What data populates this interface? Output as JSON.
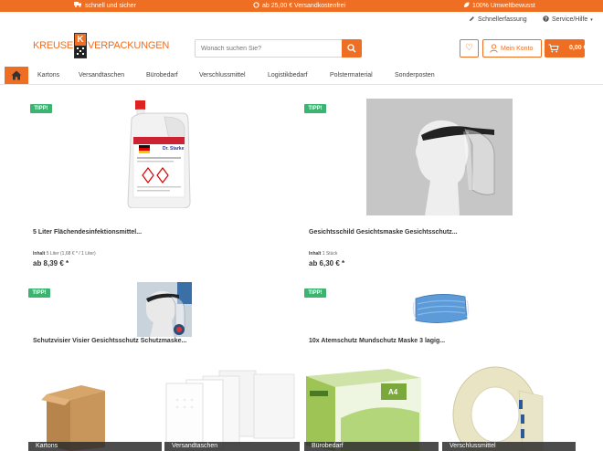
{
  "topbar": {
    "items": [
      {
        "icon": "truck-icon",
        "text": "schnell und sicher"
      },
      {
        "icon": "refresh-icon",
        "text": "ab 25,00 € Versandkostenfrei"
      },
      {
        "icon": "leaf-icon",
        "text": "100% Umweltbewusst"
      }
    ]
  },
  "service": {
    "quick_order": "Schnellerfassung",
    "help": "Service/Hilfe"
  },
  "logo": {
    "left": "KREUSER",
    "mark": "K",
    "right": "VERPACKUNGEN"
  },
  "search": {
    "placeholder": "Wonach suchen Sie?"
  },
  "header": {
    "account_label": "Mein Konto",
    "cart_label": "0,00 € *"
  },
  "nav": {
    "items": [
      "Kartons",
      "Versandtaschen",
      "Bürobedarf",
      "Verschlussmittel",
      "Logistikbedarf",
      "Polstermaterial",
      "Sonderposten"
    ]
  },
  "products": [
    {
      "badge": "TIPP!",
      "title": "5 Liter Flächendesinfektionsmittel...",
      "content_label": "Inhalt",
      "content_value": "5 Liter (1,68 € * / 1 Liter)",
      "price": "ab 8,39 € *",
      "image_text": "Dr. Starke"
    },
    {
      "badge": "TIPP!",
      "title": "Gesichtsschild Gesichtsmaske Gesichtsschutz...",
      "content_label": "Inhalt",
      "content_value": "1 Stück",
      "price": "ab 6,30 € *"
    },
    {
      "badge": "TIPP!",
      "title": "Schutzvisier Visier Gesichtsschutz Schutzmaske..."
    },
    {
      "badge": "TIPP!",
      "title": "10x Atemschutz Mundschutz Maske 3 lagig..."
    }
  ],
  "categories": [
    "Kartons",
    "Versandtaschen",
    "Bürobedarf",
    "Verschlussmittel"
  ],
  "colors": {
    "accent": "#ee6f23",
    "badge": "#3cb371",
    "dark": "#333333"
  }
}
